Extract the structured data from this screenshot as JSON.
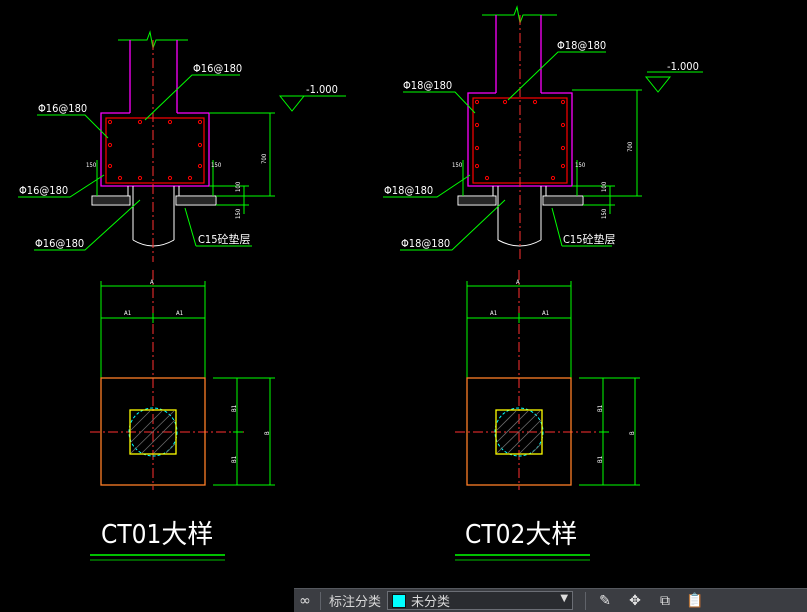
{
  "drawing": {
    "left_detail": {
      "title": "CT01大样",
      "column_rebar_label": "Φ16@180",
      "left_rebar_label": "Φ16@180",
      "bottom_rebar_label": "Φ16@180",
      "pile_rebar_label": "Φ16@180",
      "elevation_label": "-1.000",
      "cushion_label": "C15砼垫层",
      "dim_150_left": "150",
      "dim_150_right": "150",
      "dim_700": "700",
      "dim_100": "100",
      "dim_150_bottom": "150",
      "plan_dim_a": "A",
      "plan_dim_a1_left": "A1",
      "plan_dim_a1_right": "A1",
      "plan_dim_b": "B",
      "plan_dim_b1_top": "B1",
      "plan_dim_b1_bottom": "B1"
    },
    "right_detail": {
      "title": "CT02大样",
      "column_rebar_label": "Φ18@180",
      "left_rebar_label": "Φ18@180",
      "bottom_rebar_label": "Φ18@180",
      "pile_rebar_label": "Φ18@180",
      "elevation_label": "-1.000",
      "cushion_label": "C15砼垫层",
      "dim_150_left": "150",
      "dim_150_right": "150",
      "dim_700": "700",
      "dim_100": "100",
      "dim_150_bottom": "150",
      "plan_dim_a": "A",
      "plan_dim_a1_left": "A1",
      "plan_dim_a1_right": "A1",
      "plan_dim_b": "B",
      "plan_dim_b1_top": "B1",
      "plan_dim_b1_bottom": "B1"
    }
  },
  "toolbar": {
    "icon_left": "link-icon",
    "category_label": "标注分类",
    "category_value": "未分类",
    "category_color": "#00ffff",
    "buttons": [
      "edit-icon",
      "move-icon",
      "copy-icon",
      "paste-icon"
    ]
  },
  "colors": {
    "background": "#000000",
    "dimension": "#00ff00",
    "outline_magenta": "#ff00ff",
    "concrete_red": "#ff0000",
    "centerline": "#ff3030",
    "white": "#ffffff",
    "plan_outline": "#ff7f27",
    "plan_column": "#ffff00"
  }
}
